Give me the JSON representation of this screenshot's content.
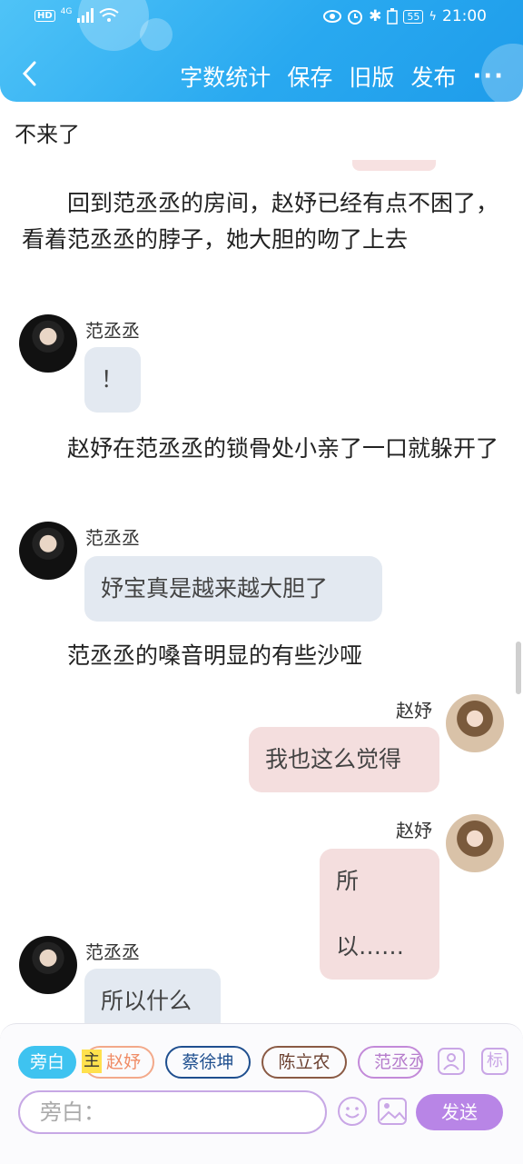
{
  "status_bar": {
    "network": "4G",
    "hd": "HD",
    "battery": "55",
    "time": "21:00"
  },
  "toolbar": {
    "word_count": "字数统计",
    "save": "保存",
    "old_version": "旧版",
    "publish": "发布",
    "more": "···"
  },
  "content": {
    "top_text": "不来了",
    "narration_1": "　　回到范丞丞的房间，赵妤已经有点不困了，看着范丞丞的脖子，她大胆的吻了上去",
    "narration_2": "　　赵妤在范丞丞的锁骨处小亲了一口就躲开了",
    "narration_3": "　　范丞丞的嗓音明显的有些沙哑",
    "messages": [
      {
        "name": "范丞丞",
        "text": "！"
      },
      {
        "name": "范丞丞",
        "text": "妤宝真是越来越大胆了"
      },
      {
        "name": "赵妤",
        "text": "我也这么觉得"
      },
      {
        "name": "赵妤",
        "text": "所以……"
      },
      {
        "name": "范丞丞",
        "text": "所以什么"
      }
    ]
  },
  "roles": {
    "pangbai": "旁白",
    "main_tag": "主",
    "zhao": "赵妤",
    "cai": "蔡徐坤",
    "chen": "陈立农",
    "fan": "范丞丞",
    "tag_icon": "标"
  },
  "input": {
    "placeholder": "旁白：",
    "send": "发送"
  },
  "colors": {
    "header": "#29a9f0",
    "accent_purple": "#b885e6",
    "chip_blue": "#3ec3f0",
    "left_bubble": "#e3e9f1",
    "right_bubble": "#f4dede"
  },
  "icons": [
    "back-icon",
    "eye-icon",
    "alarm-icon",
    "bluetooth-icon",
    "battery-icon",
    "signal-icon",
    "wifi-icon",
    "person-icon",
    "emoji-icon",
    "image-icon"
  ]
}
